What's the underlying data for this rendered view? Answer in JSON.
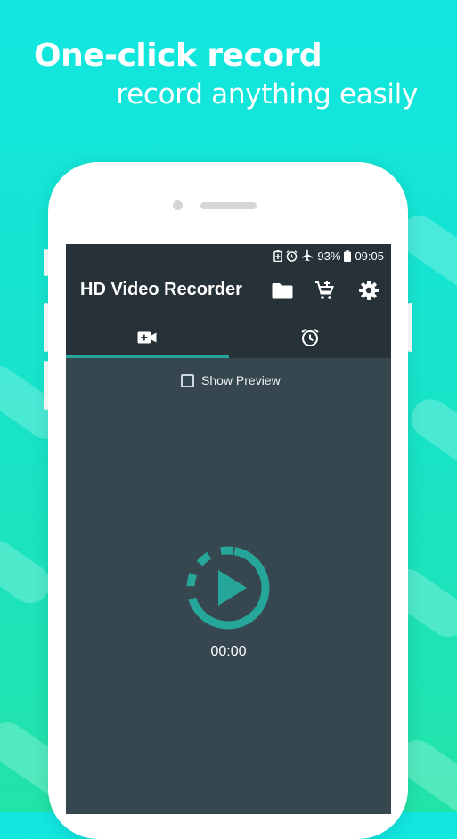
{
  "promo": {
    "headline": "One-click record",
    "subline": "record anything easily"
  },
  "status_bar": {
    "battery_percent": "93%",
    "time": "09:05",
    "icons": [
      "battery-saver-icon",
      "alarm-icon",
      "airplane-icon",
      "battery-icon"
    ]
  },
  "app": {
    "title": "HD Video Recorder",
    "actions": [
      "folder-icon",
      "cart-add-icon",
      "settings-icon"
    ]
  },
  "tabs": [
    {
      "icon": "video-camera-icon",
      "selected": true
    },
    {
      "icon": "alarm-clock-icon",
      "selected": false
    }
  ],
  "preview": {
    "label": "Show Preview",
    "checked": false
  },
  "recorder": {
    "timer": "00:00"
  },
  "colors": {
    "accent": "#26a69a",
    "appbar": "#263238",
    "screen": "#37474f",
    "background_top": "#11e6e0",
    "background_bottom": "#22e3a8"
  }
}
